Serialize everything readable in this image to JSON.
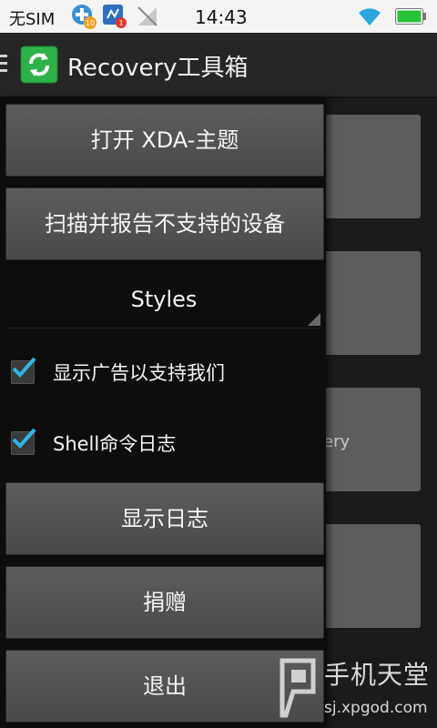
{
  "status_bar": {
    "carrier": "无SIM",
    "time": "14:43",
    "badge_1": "10",
    "badge_2": "1"
  },
  "app": {
    "title": "Recovery工具箱",
    "accent": "#2fb14a"
  },
  "drawer": {
    "open_xda_button": "打开 XDA-主题",
    "scan_report_button": "扫描并报告不支持的设备",
    "styles_spinner": "Styles",
    "show_ads_checkbox": {
      "label": "显示广告以支持我们",
      "checked": true
    },
    "shell_log_checkbox": {
      "label": "Shell命令日志",
      "checked": true
    },
    "show_log_button": "显示日志",
    "donate_button": "捐赠",
    "exit_button": "退出"
  },
  "background": {
    "partial_card_text": "ery"
  },
  "watermark": {
    "title": "手机天堂",
    "url": "sj.xpgod.com"
  },
  "icons": [
    "drawer-menu-icon",
    "app-refresh-icon",
    "wifi-icon",
    "battery-icon",
    "checkmark-icon"
  ]
}
